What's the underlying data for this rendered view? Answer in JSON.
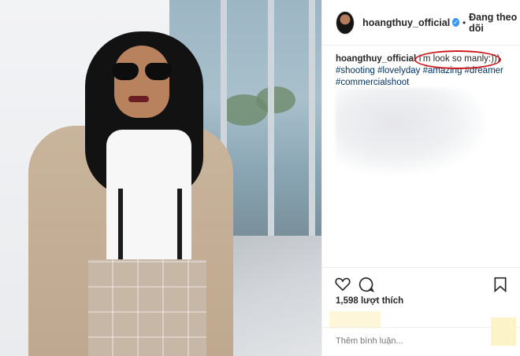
{
  "profile": {
    "username": "hoangthuy_official",
    "follow_status": "Đang theo dõi",
    "separator": "•",
    "verified_icon": "verified-badge-icon"
  },
  "caption": {
    "username": "hoangthuy_official",
    "text": "I'm look so manly:)))",
    "hashtags": "#shooting #lovelyday #amazing #dreamer #commercialshoot",
    "annotation_color": "#d0191f"
  },
  "actions": {
    "like_icon": "heart-icon",
    "comment_icon": "comment-icon",
    "save_icon": "bookmark-icon"
  },
  "likes": "1,598 lượt thích",
  "comment_box": {
    "placeholder": "Thêm bình luận..."
  },
  "colors": {
    "link": "#003569",
    "verified": "#3897f0",
    "divider": "#efefef"
  }
}
